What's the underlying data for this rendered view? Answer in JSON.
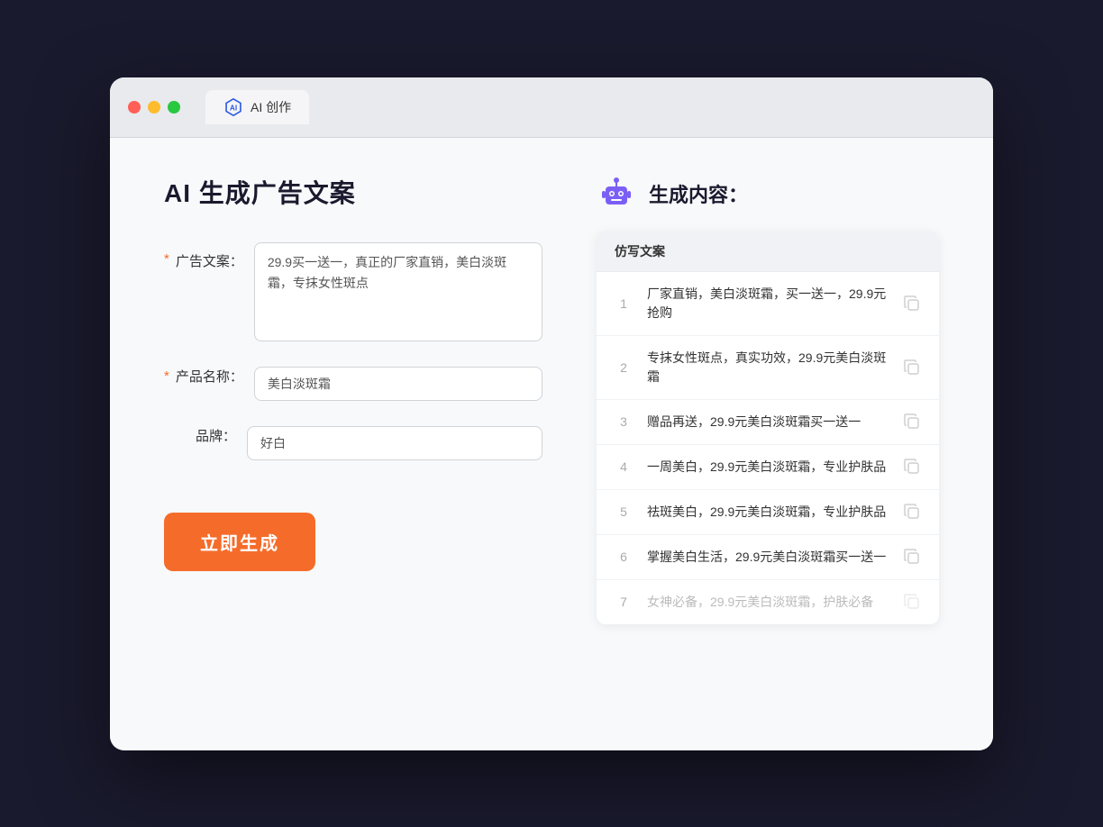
{
  "window": {
    "tab_label": "AI 创作"
  },
  "left": {
    "page_title": "AI 生成广告文案",
    "fields": [
      {
        "id": "ad_copy",
        "label": "广告文案：",
        "required": true,
        "type": "textarea",
        "value": "29.9买一送一，真正的厂家直销，美白淡斑霜，专抹女性斑点"
      },
      {
        "id": "product_name",
        "label": "产品名称：",
        "required": true,
        "type": "input",
        "value": "美白淡斑霜"
      },
      {
        "id": "brand",
        "label": "品牌：",
        "required": false,
        "type": "input",
        "value": "好白"
      }
    ],
    "button_label": "立即生成"
  },
  "right": {
    "section_title": "生成内容：",
    "table_header": "仿写文案",
    "results": [
      {
        "id": 1,
        "text": "厂家直销，美白淡斑霜，买一送一，29.9元抢购",
        "dimmed": false
      },
      {
        "id": 2,
        "text": "专抹女性斑点，真实功效，29.9元美白淡斑霜",
        "dimmed": false
      },
      {
        "id": 3,
        "text": "赠品再送，29.9元美白淡斑霜买一送一",
        "dimmed": false
      },
      {
        "id": 4,
        "text": "一周美白，29.9元美白淡斑霜，专业护肤品",
        "dimmed": false
      },
      {
        "id": 5,
        "text": "祛斑美白，29.9元美白淡斑霜，专业护肤品",
        "dimmed": false
      },
      {
        "id": 6,
        "text": "掌握美白生活，29.9元美白淡斑霜买一送一",
        "dimmed": false
      },
      {
        "id": 7,
        "text": "女神必备，29.9元美白淡斑霜，护肤必备",
        "dimmed": true
      }
    ]
  }
}
